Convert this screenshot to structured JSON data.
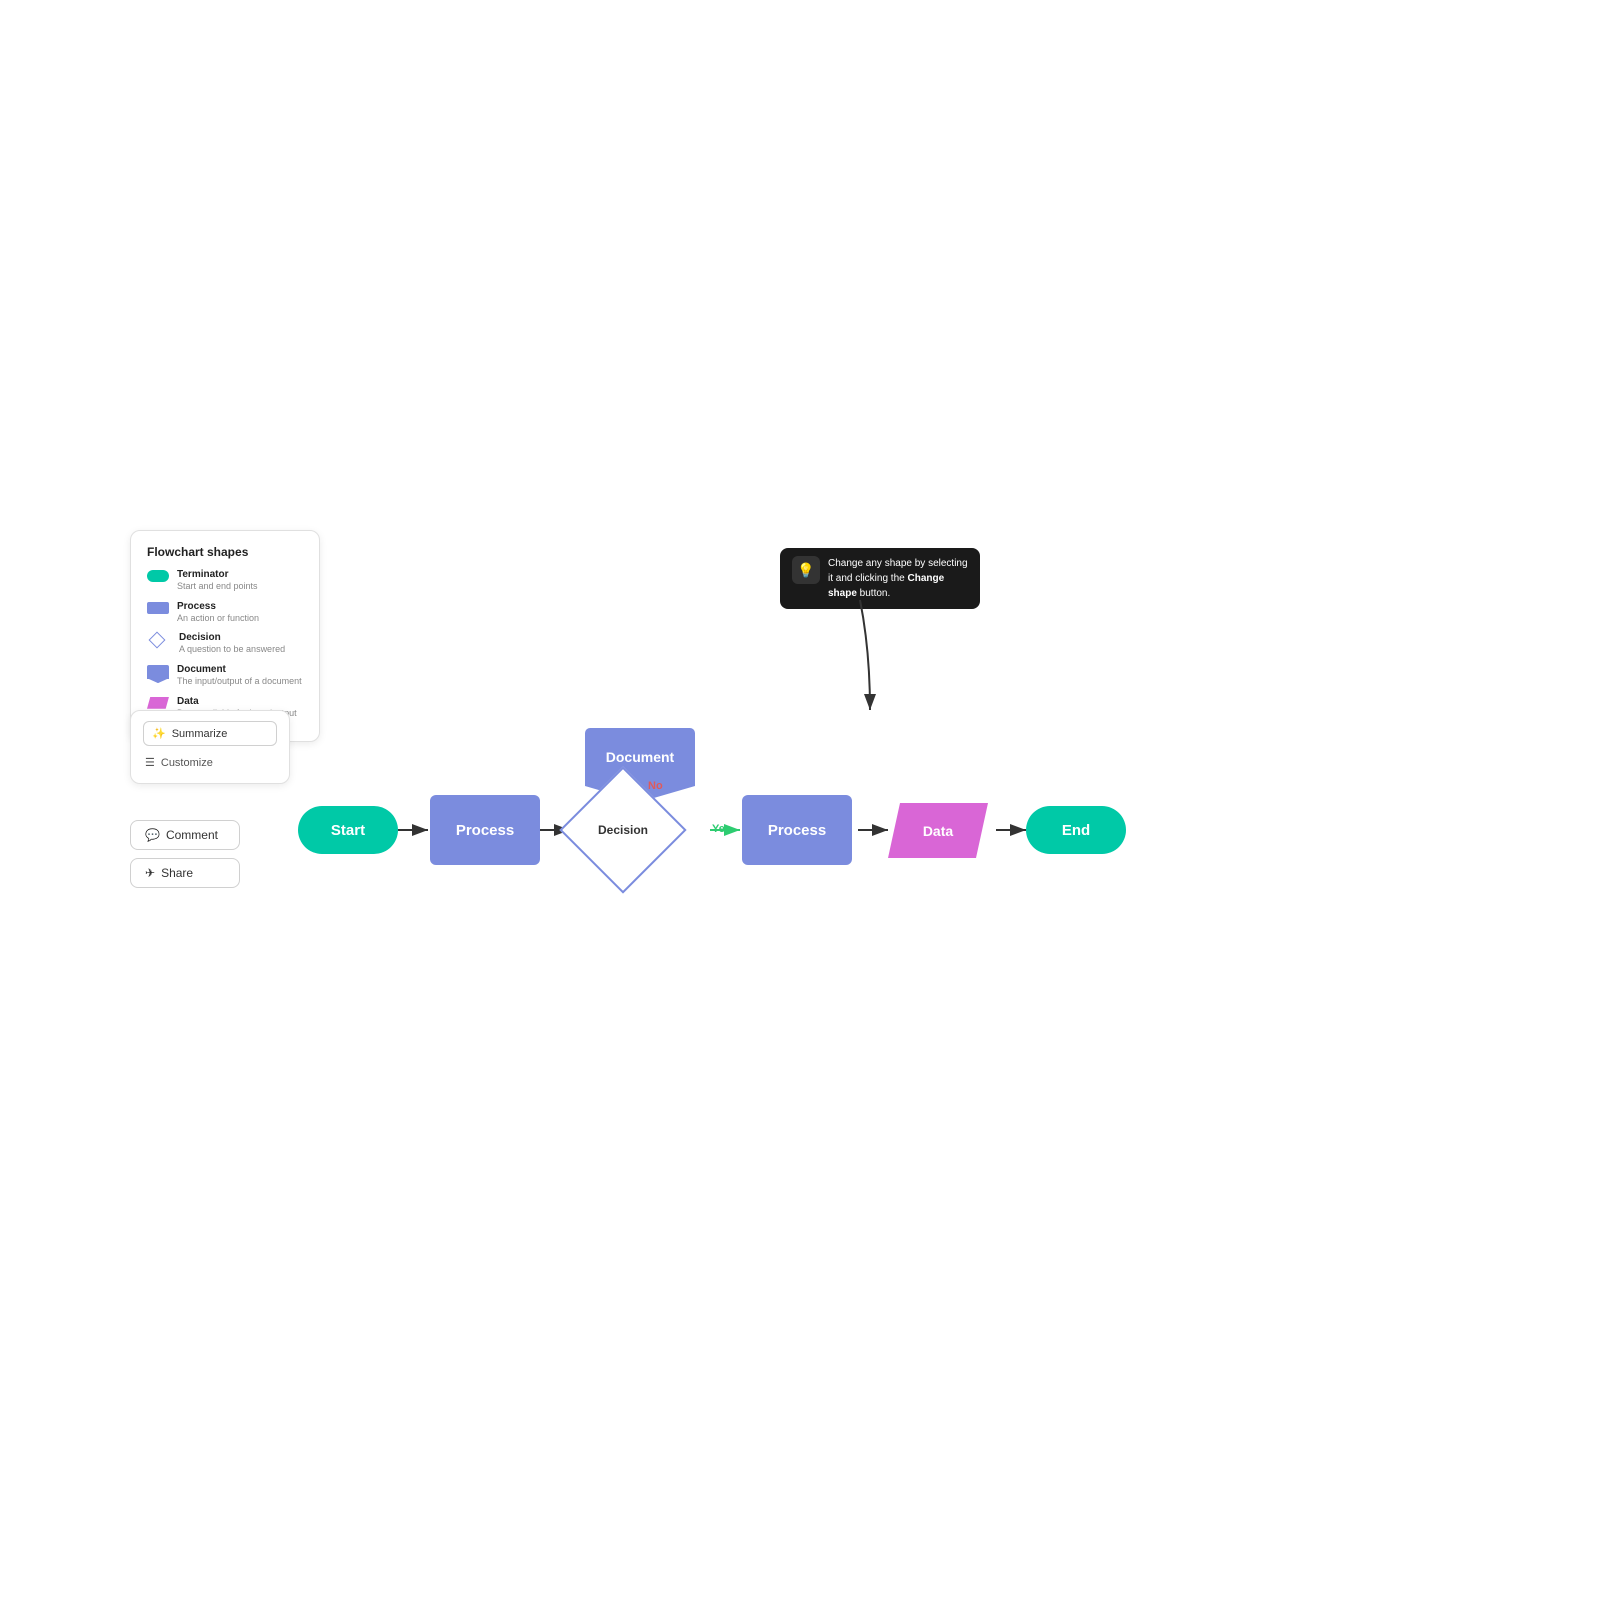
{
  "legend": {
    "title": "Flowchart shapes",
    "items": [
      {
        "id": "terminator",
        "label": "Terminator",
        "desc": "Start and end points"
      },
      {
        "id": "process",
        "label": "Process",
        "desc": "An action or function"
      },
      {
        "id": "decision",
        "label": "Decision",
        "desc": "A question to be answered"
      },
      {
        "id": "document",
        "label": "Document",
        "desc": "The input/output of a document"
      },
      {
        "id": "data",
        "label": "Data",
        "desc": "Data available for input/output"
      }
    ]
  },
  "action_panel": {
    "summarize_label": "Summarize",
    "customize_label": "Customize"
  },
  "buttons": {
    "comment_label": "Comment",
    "share_label": "Share"
  },
  "hint": {
    "text": "Change any shape by selecting it and clicking the ",
    "bold": "Change shape",
    "text2": " button."
  },
  "flowchart": {
    "nodes": {
      "start": "Start",
      "process1": "Process",
      "decision": "Decision",
      "process2": "Process",
      "data": "Data",
      "end": "End",
      "document": "Document"
    },
    "edges": {
      "yes": "Yes",
      "no": "No"
    }
  },
  "colors": {
    "teal": "#00c9a7",
    "blue_process": "#7b8cde",
    "pink_data": "#d966d6",
    "white": "#ffffff",
    "dark": "#1a1a1a",
    "red": "#e05a5a"
  }
}
